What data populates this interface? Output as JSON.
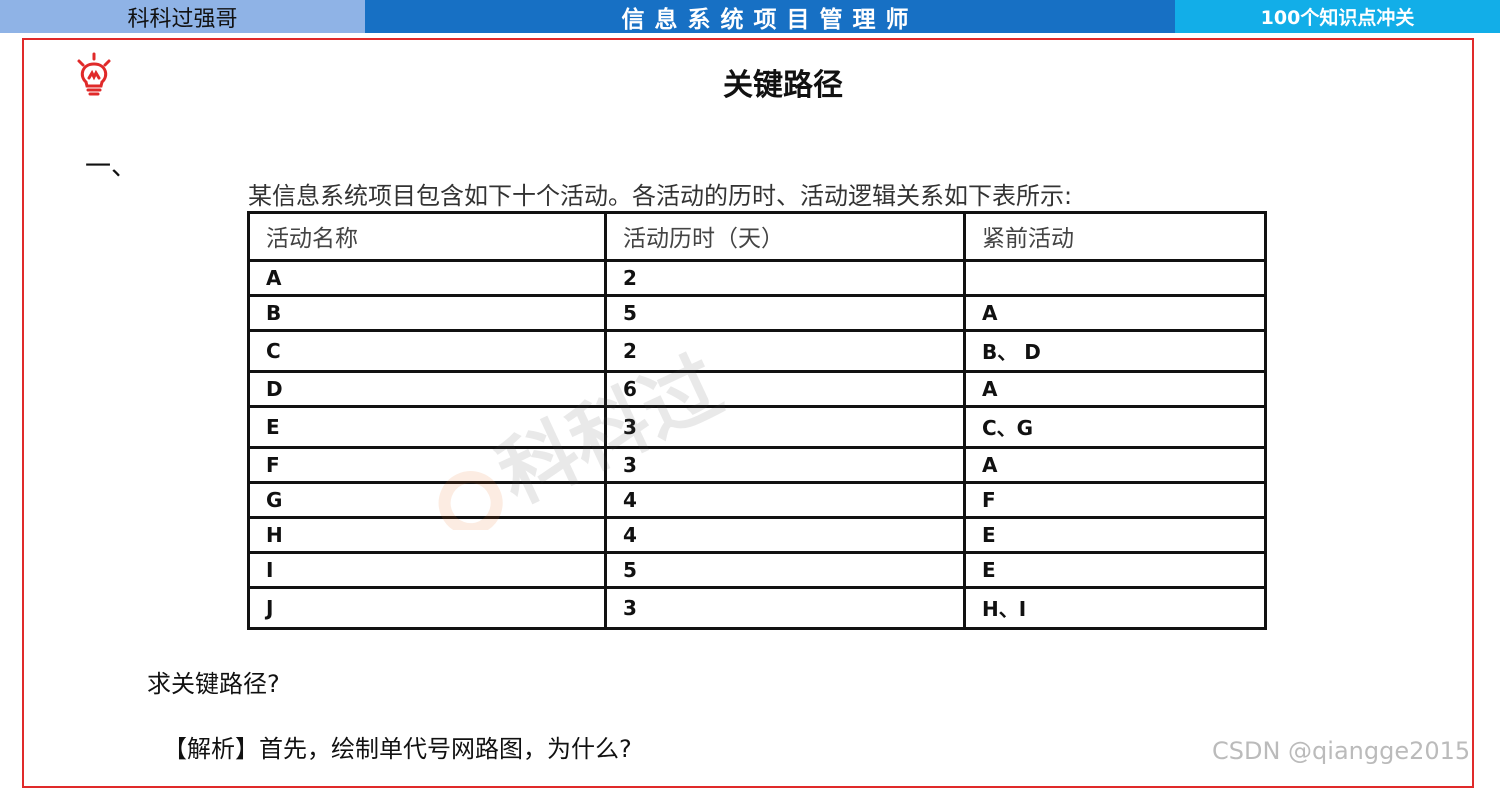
{
  "header": {
    "left": "科科过强哥",
    "center": "信息系统项目管理师",
    "right": "100个知识点冲关"
  },
  "icon": "lightbulb-icon",
  "title": "关键路径",
  "section_no": "一、",
  "intro": "某信息系统项目包含如下十个活动。各活动的历时、活动逻辑关系如下表所示:",
  "table": {
    "headers": [
      "活动名称",
      "活动历时（天）",
      "紧前活动"
    ],
    "rows": [
      [
        "A",
        "2",
        ""
      ],
      [
        "B",
        "5",
        "A"
      ],
      [
        "C",
        "2",
        "B、 D"
      ],
      [
        "D",
        "6",
        "A"
      ],
      [
        "E",
        "3",
        "C、G"
      ],
      [
        "F",
        "3",
        "A"
      ],
      [
        "G",
        "4",
        "F"
      ],
      [
        "H",
        "4",
        "E"
      ],
      [
        "I",
        "5",
        "E"
      ],
      [
        "J",
        "3",
        "H、I"
      ]
    ]
  },
  "watermark": "科科过",
  "question": "求关键路径?",
  "analysis": "【解析】首先，绘制单代号网路图，为什么?",
  "footer_watermark": "CSDN @qiangge2015",
  "colors": {
    "header_left": "#8fb3e6",
    "header_center": "#1770c4",
    "header_right": "#12aee8",
    "frame": "#e02a2a",
    "icon": "#e02a2a"
  }
}
